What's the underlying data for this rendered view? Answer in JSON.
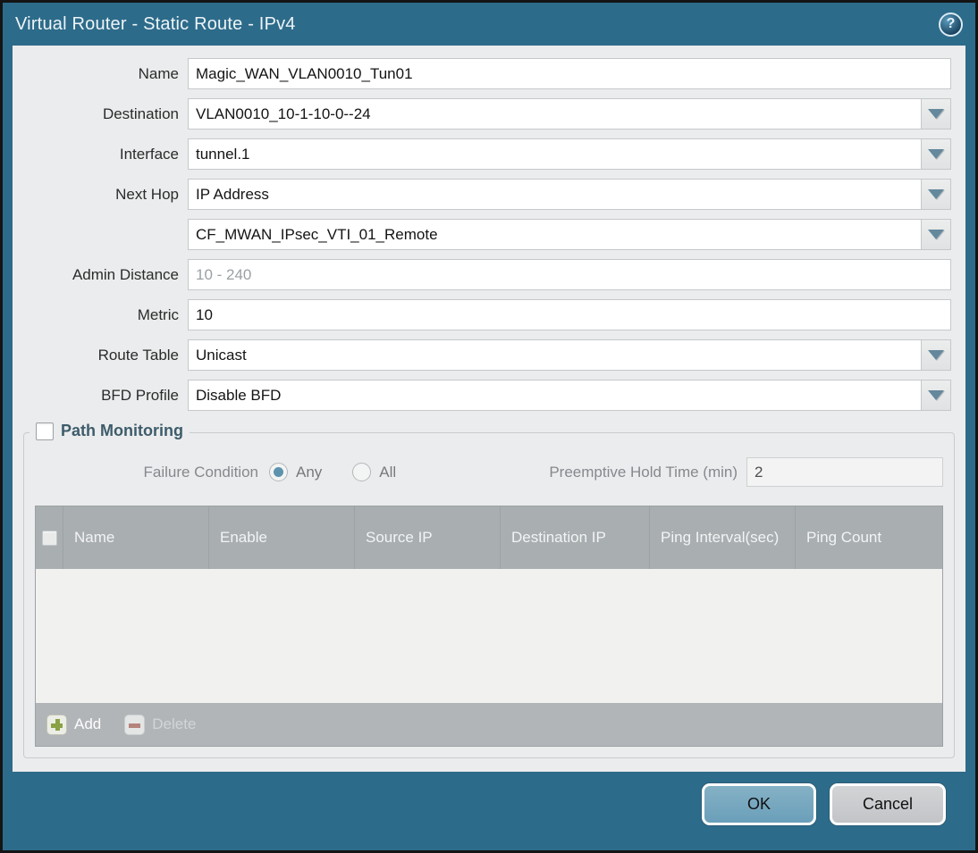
{
  "titlebar": {
    "title": "Virtual Router - Static Route - IPv4",
    "help_glyph": "?"
  },
  "form": {
    "name": {
      "label": "Name",
      "value": "Magic_WAN_VLAN0010_Tun01"
    },
    "destination": {
      "label": "Destination",
      "value": "VLAN0010_10-1-10-0--24"
    },
    "interface": {
      "label": "Interface",
      "value": "tunnel.1"
    },
    "next_hop": {
      "label": "Next Hop",
      "value": "IP Address"
    },
    "next_hop_address": {
      "value": "CF_MWAN_IPsec_VTI_01_Remote"
    },
    "admin_distance": {
      "label": "Admin Distance",
      "value": "",
      "placeholder": "10 - 240"
    },
    "metric": {
      "label": "Metric",
      "value": "10"
    },
    "route_table": {
      "label": "Route Table",
      "value": "Unicast"
    },
    "bfd_profile": {
      "label": "BFD Profile",
      "value": "Disable BFD"
    }
  },
  "path_monitoring": {
    "title": "Path Monitoring",
    "checked": false,
    "failure_condition": {
      "label": "Failure Condition",
      "options": [
        {
          "label": "Any",
          "selected": true
        },
        {
          "label": "All",
          "selected": false
        }
      ]
    },
    "preemptive_hold_time": {
      "label": "Preemptive Hold Time (min)",
      "value": "2"
    },
    "table": {
      "columns": [
        "Name",
        "Enable",
        "Source IP",
        "Destination IP",
        "Ping Interval(sec)",
        "Ping Count"
      ],
      "rows": [],
      "add_label": "Add",
      "delete_label": "Delete"
    }
  },
  "footer": {
    "ok_label": "OK",
    "cancel_label": "Cancel"
  },
  "colors": {
    "frame_teal": "#2d6b8a",
    "panel_gray": "#ebeced",
    "table_header_gray": "#a9aeb1",
    "ok_button_blue": "#74a6be",
    "cancel_button_gray": "#c9cbce",
    "add_plus_green": "#8aa144",
    "delete_minus_red": "#b5837b"
  }
}
